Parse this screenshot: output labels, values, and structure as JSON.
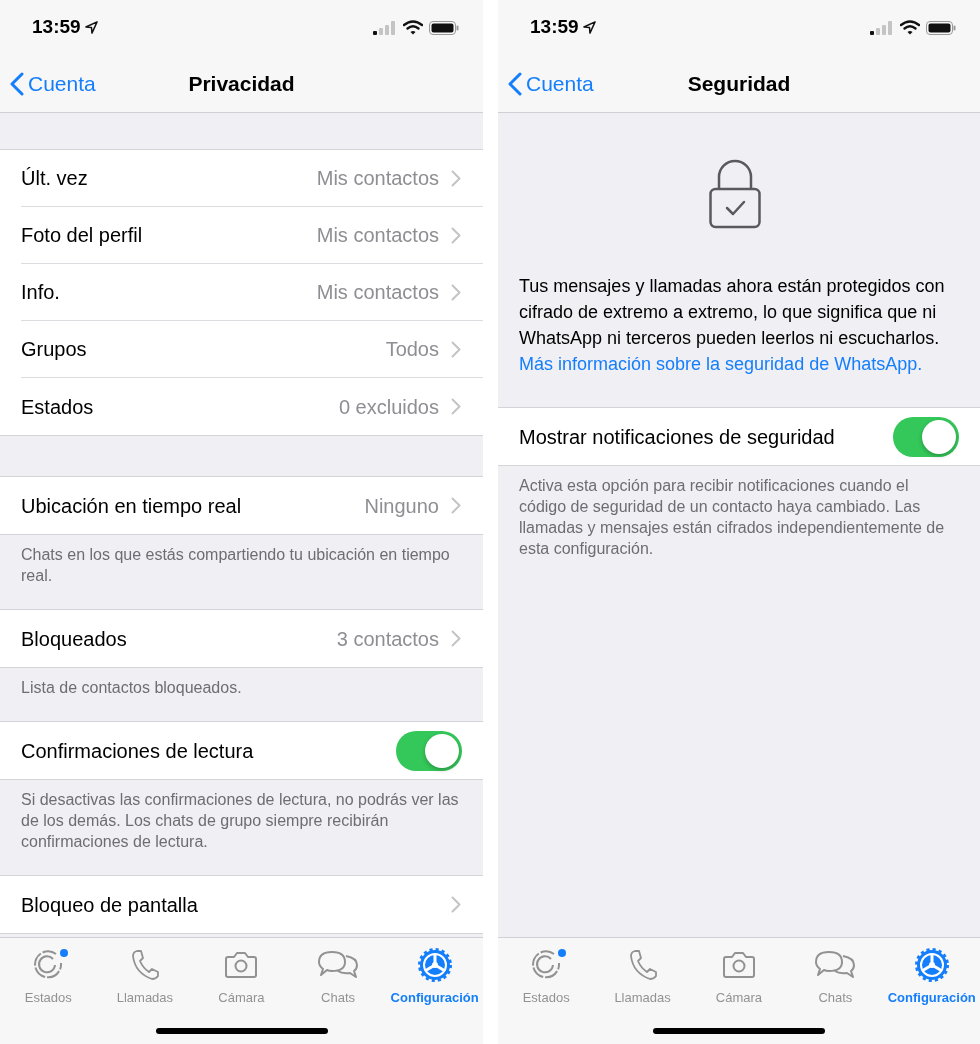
{
  "screens": [
    {
      "status_bar": {
        "time": "13:59"
      },
      "nav": {
        "back": "Cuenta",
        "title": "Privacidad"
      },
      "sections": [
        {
          "kind": "group",
          "rows": [
            {
              "kind": "value",
              "label": "Últ. vez",
              "value": "Mis contactos"
            },
            {
              "kind": "value",
              "label": "Foto del perfil",
              "value": "Mis contactos"
            },
            {
              "kind": "value",
              "label": "Info.",
              "value": "Mis contactos"
            },
            {
              "kind": "value",
              "label": "Grupos",
              "value": "Todos"
            },
            {
              "kind": "value",
              "label": "Estados",
              "value": "0 excluidos"
            }
          ]
        },
        {
          "kind": "group",
          "rows": [
            {
              "kind": "value",
              "label": "Ubicación en tiempo real",
              "value": "Ninguno"
            }
          ],
          "footer": "Chats en los que estás compartiendo tu ubicación en tiempo real."
        },
        {
          "kind": "group",
          "rows": [
            {
              "kind": "value",
              "label": "Bloqueados",
              "value": "3 contactos"
            }
          ],
          "footer": "Lista de contactos bloqueados."
        },
        {
          "kind": "group",
          "rows": [
            {
              "kind": "toggle",
              "label": "Confirmaciones de lectura",
              "on": true
            }
          ],
          "footer": "Si desactivas las confirmaciones de lectura, no podrás ver las de los demás. Los chats de grupo siempre recibirán confirmaciones de lectura."
        },
        {
          "kind": "group",
          "rows": [
            {
              "kind": "value",
              "label": "Bloqueo de pantalla"
            }
          ]
        }
      ],
      "tab_bar": [
        {
          "kind": "status",
          "label": "Estados",
          "selected": false,
          "badge": true
        },
        {
          "kind": "calls",
          "label": "Llamadas",
          "selected": false,
          "badge": false
        },
        {
          "kind": "camera",
          "label": "Cámara",
          "selected": false,
          "badge": false
        },
        {
          "kind": "chats",
          "label": "Chats",
          "selected": false,
          "badge": false
        },
        {
          "kind": "settings",
          "label": "Configuración",
          "selected": true,
          "badge": false
        }
      ]
    },
    {
      "status_bar": {
        "time": "13:59"
      },
      "nav": {
        "back": "Cuenta",
        "title": "Seguridad"
      },
      "sections": [
        {
          "kind": "intro",
          "text": "Tus mensajes y llamadas ahora están protegidos con cifrado de extremo a extremo, lo que significa que ni WhatsApp ni terceros pueden leerlos ni escucharlos.",
          "link": "Más información sobre la seguridad de WhatsApp."
        },
        {
          "kind": "group",
          "rows": [
            {
              "kind": "toggle",
              "label": "Mostrar notificaciones de seguridad",
              "on": true
            }
          ],
          "footer": "Activa esta opción para recibir notificaciones cuando el código de seguridad de un contacto haya cambiado. Las llamadas y mensajes están cifrados independientemente de esta configuración."
        }
      ],
      "tab_bar": [
        {
          "kind": "status",
          "label": "Estados",
          "selected": false,
          "badge": true
        },
        {
          "kind": "calls",
          "label": "Llamadas",
          "selected": false,
          "badge": false
        },
        {
          "kind": "camera",
          "label": "Cámara",
          "selected": false,
          "badge": false
        },
        {
          "kind": "chats",
          "label": "Chats",
          "selected": false,
          "badge": false
        },
        {
          "kind": "settings",
          "label": "Configuración",
          "selected": true,
          "badge": false
        }
      ]
    }
  ]
}
